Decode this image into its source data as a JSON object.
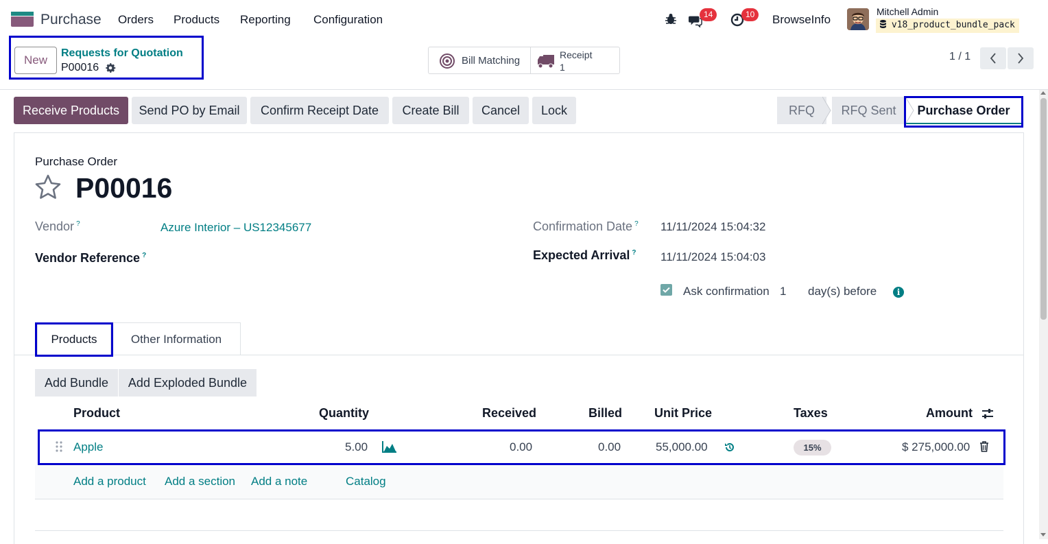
{
  "navbar": {
    "app_name": "Purchase",
    "menu": [
      "Orders",
      "Products",
      "Reporting",
      "Configuration"
    ],
    "messages_count": "14",
    "activities_count": "10",
    "company": "BrowseInfo",
    "user_name": "Mitchell Admin",
    "db_name": "v18_product_bundle_pack",
    "icons": [
      "bug-icon",
      "chat-icon",
      "clock-icon",
      "database-icon"
    ]
  },
  "control": {
    "new_label": "New",
    "breadcrumb_parent": "Requests for Quotation",
    "breadcrumb_current": "P00016",
    "smart_bill": "Bill Matching",
    "smart_receipt_label": "Receipt",
    "smart_receipt_count": "1",
    "pager": "1 / 1"
  },
  "actions": {
    "receive": "Receive Products",
    "send": "Send PO by Email",
    "confirm_date": "Confirm Receipt Date",
    "create_bill": "Create Bill",
    "cancel": "Cancel",
    "lock": "Lock"
  },
  "statusbar": {
    "stages": [
      "RFQ",
      "RFQ Sent",
      "Purchase Order"
    ],
    "current": "Purchase Order"
  },
  "form": {
    "title": "Purchase Order",
    "name": "P00016",
    "vendor_label": "Vendor",
    "vendor_value": "Azure Interior – US12345677",
    "vendor_ref_label": "Vendor Reference",
    "confirmation_label": "Confirmation Date",
    "confirmation_value": "11/11/2024 15:04:32",
    "expected_label": "Expected Arrival",
    "expected_value": "11/11/2024 15:04:03",
    "ask_confirmation_label": "Ask confirmation",
    "ask_days": "1",
    "days_before": "day(s) before",
    "tooltip_mark": "?",
    "info_mark": "i"
  },
  "tabs": [
    "Products",
    "Other Information"
  ],
  "bundle_buttons": [
    "Add Bundle",
    "Add Exploded Bundle"
  ],
  "table": {
    "headers": [
      "Product",
      "Quantity",
      "Received",
      "Billed",
      "Unit Price",
      "Taxes",
      "Amount"
    ],
    "rows": [
      {
        "product": "Apple",
        "quantity": "5.00",
        "received": "0.00",
        "billed": "0.00",
        "unit_price": "55,000.00",
        "taxes": "15%",
        "amount": "$ 275,000.00"
      }
    ],
    "add_links": [
      "Add a product",
      "Add a section",
      "Add a note",
      "Catalog"
    ]
  },
  "colors": {
    "primary": "#714b67",
    "link": "#017e84",
    "highlight": "#0000cc"
  }
}
